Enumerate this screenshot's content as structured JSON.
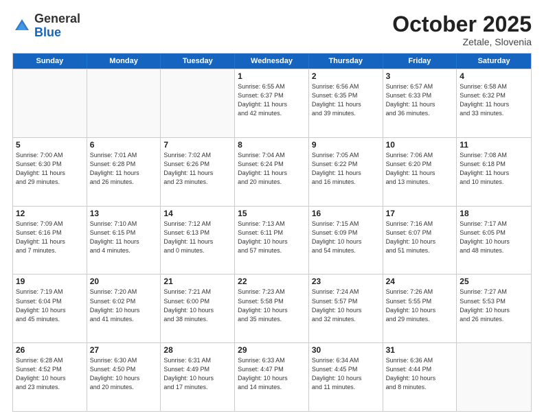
{
  "header": {
    "logo_general": "General",
    "logo_blue": "Blue",
    "month": "October 2025",
    "location": "Zetale, Slovenia"
  },
  "weekdays": [
    "Sunday",
    "Monday",
    "Tuesday",
    "Wednesday",
    "Thursday",
    "Friday",
    "Saturday"
  ],
  "weeks": [
    [
      {
        "day": "",
        "text": ""
      },
      {
        "day": "",
        "text": ""
      },
      {
        "day": "",
        "text": ""
      },
      {
        "day": "1",
        "text": "Sunrise: 6:55 AM\nSunset: 6:37 PM\nDaylight: 11 hours\nand 42 minutes."
      },
      {
        "day": "2",
        "text": "Sunrise: 6:56 AM\nSunset: 6:35 PM\nDaylight: 11 hours\nand 39 minutes."
      },
      {
        "day": "3",
        "text": "Sunrise: 6:57 AM\nSunset: 6:33 PM\nDaylight: 11 hours\nand 36 minutes."
      },
      {
        "day": "4",
        "text": "Sunrise: 6:58 AM\nSunset: 6:32 PM\nDaylight: 11 hours\nand 33 minutes."
      }
    ],
    [
      {
        "day": "5",
        "text": "Sunrise: 7:00 AM\nSunset: 6:30 PM\nDaylight: 11 hours\nand 29 minutes."
      },
      {
        "day": "6",
        "text": "Sunrise: 7:01 AM\nSunset: 6:28 PM\nDaylight: 11 hours\nand 26 minutes."
      },
      {
        "day": "7",
        "text": "Sunrise: 7:02 AM\nSunset: 6:26 PM\nDaylight: 11 hours\nand 23 minutes."
      },
      {
        "day": "8",
        "text": "Sunrise: 7:04 AM\nSunset: 6:24 PM\nDaylight: 11 hours\nand 20 minutes."
      },
      {
        "day": "9",
        "text": "Sunrise: 7:05 AM\nSunset: 6:22 PM\nDaylight: 11 hours\nand 16 minutes."
      },
      {
        "day": "10",
        "text": "Sunrise: 7:06 AM\nSunset: 6:20 PM\nDaylight: 11 hours\nand 13 minutes."
      },
      {
        "day": "11",
        "text": "Sunrise: 7:08 AM\nSunset: 6:18 PM\nDaylight: 11 hours\nand 10 minutes."
      }
    ],
    [
      {
        "day": "12",
        "text": "Sunrise: 7:09 AM\nSunset: 6:16 PM\nDaylight: 11 hours\nand 7 minutes."
      },
      {
        "day": "13",
        "text": "Sunrise: 7:10 AM\nSunset: 6:15 PM\nDaylight: 11 hours\nand 4 minutes."
      },
      {
        "day": "14",
        "text": "Sunrise: 7:12 AM\nSunset: 6:13 PM\nDaylight: 11 hours\nand 0 minutes."
      },
      {
        "day": "15",
        "text": "Sunrise: 7:13 AM\nSunset: 6:11 PM\nDaylight: 10 hours\nand 57 minutes."
      },
      {
        "day": "16",
        "text": "Sunrise: 7:15 AM\nSunset: 6:09 PM\nDaylight: 10 hours\nand 54 minutes."
      },
      {
        "day": "17",
        "text": "Sunrise: 7:16 AM\nSunset: 6:07 PM\nDaylight: 10 hours\nand 51 minutes."
      },
      {
        "day": "18",
        "text": "Sunrise: 7:17 AM\nSunset: 6:05 PM\nDaylight: 10 hours\nand 48 minutes."
      }
    ],
    [
      {
        "day": "19",
        "text": "Sunrise: 7:19 AM\nSunset: 6:04 PM\nDaylight: 10 hours\nand 45 minutes."
      },
      {
        "day": "20",
        "text": "Sunrise: 7:20 AM\nSunset: 6:02 PM\nDaylight: 10 hours\nand 41 minutes."
      },
      {
        "day": "21",
        "text": "Sunrise: 7:21 AM\nSunset: 6:00 PM\nDaylight: 10 hours\nand 38 minutes."
      },
      {
        "day": "22",
        "text": "Sunrise: 7:23 AM\nSunset: 5:58 PM\nDaylight: 10 hours\nand 35 minutes."
      },
      {
        "day": "23",
        "text": "Sunrise: 7:24 AM\nSunset: 5:57 PM\nDaylight: 10 hours\nand 32 minutes."
      },
      {
        "day": "24",
        "text": "Sunrise: 7:26 AM\nSunset: 5:55 PM\nDaylight: 10 hours\nand 29 minutes."
      },
      {
        "day": "25",
        "text": "Sunrise: 7:27 AM\nSunset: 5:53 PM\nDaylight: 10 hours\nand 26 minutes."
      }
    ],
    [
      {
        "day": "26",
        "text": "Sunrise: 6:28 AM\nSunset: 4:52 PM\nDaylight: 10 hours\nand 23 minutes."
      },
      {
        "day": "27",
        "text": "Sunrise: 6:30 AM\nSunset: 4:50 PM\nDaylight: 10 hours\nand 20 minutes."
      },
      {
        "day": "28",
        "text": "Sunrise: 6:31 AM\nSunset: 4:49 PM\nDaylight: 10 hours\nand 17 minutes."
      },
      {
        "day": "29",
        "text": "Sunrise: 6:33 AM\nSunset: 4:47 PM\nDaylight: 10 hours\nand 14 minutes."
      },
      {
        "day": "30",
        "text": "Sunrise: 6:34 AM\nSunset: 4:45 PM\nDaylight: 10 hours\nand 11 minutes."
      },
      {
        "day": "31",
        "text": "Sunrise: 6:36 AM\nSunset: 4:44 PM\nDaylight: 10 hours\nand 8 minutes."
      },
      {
        "day": "",
        "text": ""
      }
    ]
  ]
}
